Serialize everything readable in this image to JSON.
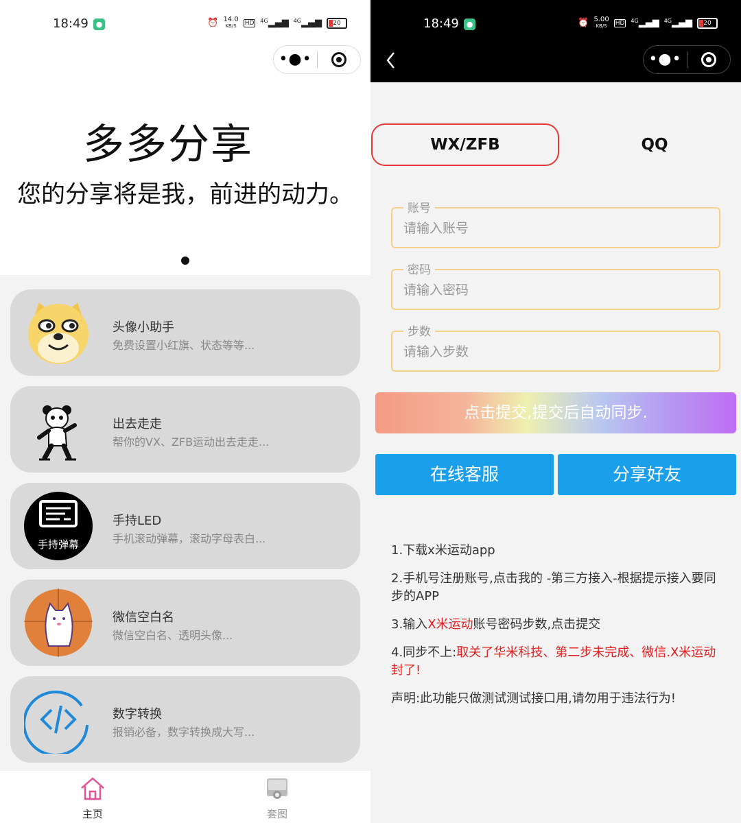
{
  "left": {
    "status": {
      "time": "18:49",
      "speed_value": "14.0",
      "speed_unit": "KB/S",
      "hd": "HD",
      "sig1": "4G",
      "sig2": "4G",
      "battery": "20"
    },
    "banner": {
      "title": "多多分享",
      "subtitle": "您的分享将是我，前进的动力。"
    },
    "cards": [
      {
        "title": "头像小助手",
        "desc": "免费设置小红旗、状态等等...",
        "icon": "doge-face-icon"
      },
      {
        "title": "出去走走",
        "desc": "帮你的VX、ZFB运动出去走走...",
        "icon": "panda-meme-icon"
      },
      {
        "title": "手持LED",
        "desc": "手机滚动弹幕，滚动字母表白...",
        "icon": "led-screen-icon",
        "icon_text": "手持弹幕"
      },
      {
        "title": "微信空白名",
        "desc": "微信空白名、透明头像...",
        "icon": "blank-avatar-icon"
      },
      {
        "title": "数字转换",
        "desc": "报销必备，数字转换成大写...",
        "icon": "code-brackets-icon"
      }
    ],
    "tabs": [
      {
        "label": "主页",
        "icon": "home-icon",
        "color": "#e0559a"
      },
      {
        "label": "套图",
        "icon": "picture-icon",
        "color": "#999999"
      }
    ]
  },
  "right": {
    "status": {
      "time": "18:49",
      "speed_value": "5.00",
      "speed_unit": "KB/S",
      "hd": "HD",
      "sig1": "4G",
      "sig2": "4G",
      "battery": "20"
    },
    "segments": {
      "wx": "WX/ZFB",
      "qq": "QQ"
    },
    "fields": [
      {
        "legend": "账号",
        "placeholder": "请输入账号"
      },
      {
        "legend": "密码",
        "placeholder": "请输入密码"
      },
      {
        "legend": "步数",
        "placeholder": "请输入步数"
      }
    ],
    "submit": "点击提交,提交后自动同步.",
    "service": "在线客服",
    "share": "分享好友",
    "notes": {
      "n1": "1.下载x米运动app",
      "n2": "2.手机号注册账号,点击我的 -第三方接入-根据提示接入要同步的APP",
      "n3a": "3.输入",
      "n3b": "X米运动",
      "n3c": "账号密码步数,点击提交",
      "n4a": "4.同步不上:",
      "n4b": "取关了华米科技、第二步未完成、微信.X米运动封了!",
      "n5": "声明:此功能只做测试测试接口用,请勿用于违法行为!"
    }
  },
  "colors": {
    "accent_blue": "#1aa0ea",
    "active_red": "#e53935",
    "field_border": "#f5d08a"
  }
}
